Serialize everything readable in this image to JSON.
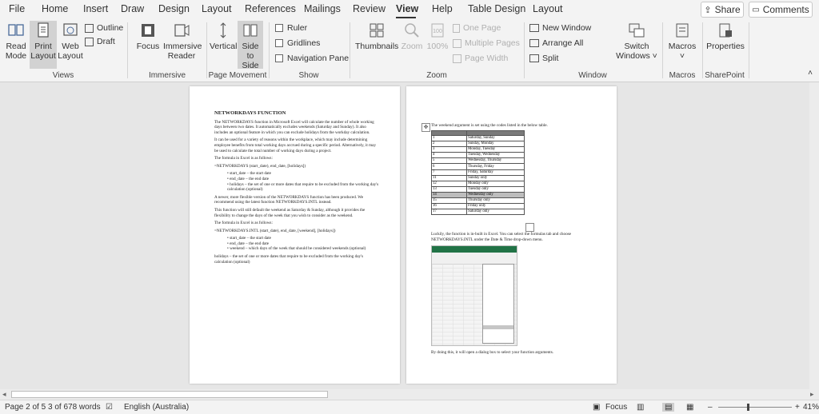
{
  "menu": {
    "tabs": [
      "File",
      "Home",
      "Insert",
      "Draw",
      "Design",
      "Layout",
      "References",
      "Mailings",
      "Review",
      "View",
      "Help",
      "Table Design",
      "Layout"
    ],
    "active_tab": "View",
    "share": "Share",
    "comments": "Comments"
  },
  "ribbon": {
    "views": {
      "read_mode_1": "Read",
      "read_mode_2": "Mode",
      "print_layout_1": "Print",
      "print_layout_2": "Layout",
      "web_layout_1": "Web",
      "web_layout_2": "Layout",
      "outline": "Outline",
      "draft": "Draft",
      "group": "Views"
    },
    "immersive": {
      "focus": "Focus",
      "reader_1": "Immersive",
      "reader_2": "Reader",
      "group": "Immersive"
    },
    "movement": {
      "vertical": "Vertical",
      "side_1": "Side",
      "side_2": "to Side",
      "group": "Page Movement"
    },
    "show": {
      "ruler": "Ruler",
      "gridlines": "Gridlines",
      "nav_pane": "Navigation Pane",
      "group": "Show"
    },
    "zoom": {
      "thumbnails": "Thumbnails",
      "zoom": "Zoom",
      "pct": "100%",
      "one_page": "One Page",
      "multiple_pages": "Multiple Pages",
      "page_width": "Page Width",
      "group": "Zoom"
    },
    "window": {
      "new_window": "New Window",
      "arrange_all": "Arrange All",
      "split": "Split",
      "switch_1": "Switch",
      "switch_2": "Windows",
      "group": "Window"
    },
    "macros": {
      "label": "Macros",
      "group": "Macros"
    },
    "sharepoint": {
      "label": "Properties",
      "group": "SharePoint"
    }
  },
  "doc_left": {
    "heading": "NETWORKDAYS FUNCTION",
    "p1": "The NETWORKDAYS function in Microsoft Excel will calculate the number of whole working days between two dates. It automatically excludes weekends (Saturday and Sunday). It also includes an optional feature in which you can exclude holidays from the workday calculation.",
    "p2": "It can be used for a variety of reasons within the workplace, which may include determining employee benefits from total working days accrued during a specific period. Alternatively, it may be used to calculate the total number of working days during a project.",
    "p3": "The formula in Excel is as follows:",
    "f1": "=NETWORKDAYS (start_date), end_date, [holidays])",
    "b1": "start_date – the start date",
    "b2": "end_date – the end date",
    "b3": "holidays – the set of one or more dates that require to be excluded from the working day's calculation (optional)",
    "p4": "A newer, more flexible version of the NETWORKDAYS function has been produced. We recommend using the latest function NETWORKDAYS.INTL instead.",
    "p5": "This function will still default the weekend as Saturday & Sunday, although it provides the flexibility to change the days of the week that you wish to consider as the weekend.",
    "p6": "The formula in Excel is as follows:",
    "f2": "=NETWORKDAYS.INTL (start_date), end_date, [weekend], [holidays])",
    "c1": "start_date – the start date",
    "c2": "end_date – the end date",
    "c3": "weekend – which days of the week that should be considered weekends (optional)",
    "p7": "holidays – the set of one or more dates that require to be excluded from the working day's calculation (optional)"
  },
  "doc_right": {
    "intro": "The weekend argument is set using the codes listed in the below table.",
    "rows": [
      [
        "1",
        "Saturday, Sunday"
      ],
      [
        "2",
        "Sunday, Monday"
      ],
      [
        "3",
        "Monday, Tuesday"
      ],
      [
        "4",
        "Tuesday, Wednesday"
      ],
      [
        "5",
        "Wednesday, Thursday"
      ],
      [
        "6",
        "Thursday, Friday"
      ],
      [
        "7",
        "Friday, Saturday"
      ],
      [
        "11",
        "Sunday only"
      ],
      [
        "12",
        "Monday only"
      ],
      [
        "13",
        "Tuesday only"
      ],
      [
        "14",
        "Wednesday only"
      ],
      [
        "15",
        "Thursday only"
      ],
      [
        "16",
        "Friday only"
      ],
      [
        "17",
        "Saturday only"
      ]
    ],
    "p1": "Luckily, the function is in-built in Excel. You can select the formulas tab and choose NETWORKDAYS.INTL under the Date & Time drop-down menu.",
    "p2": "By doing this, it will open a dialog box to select your function arguments."
  },
  "status": {
    "page": "Page 2 of 5",
    "words": "3 of 678 words",
    "language": "English (Australia)",
    "focus": "Focus",
    "zoom": "41%"
  },
  "colors": {
    "accent": "#2b579a",
    "ribbon": "#f3f3f3",
    "canvas": "#e6e6e6"
  }
}
